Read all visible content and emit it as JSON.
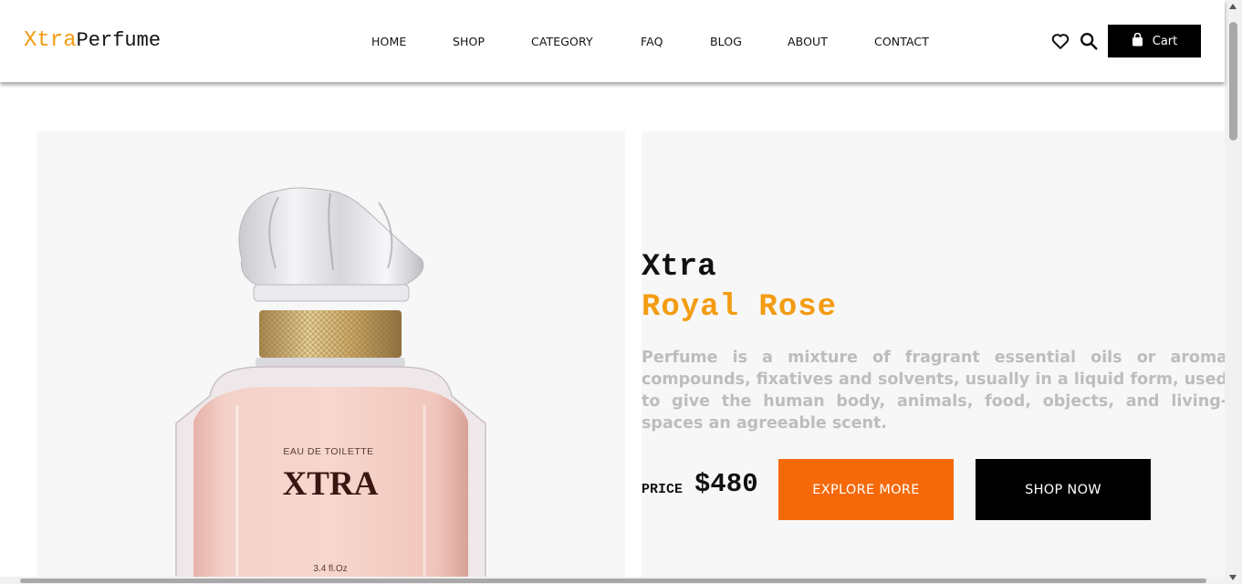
{
  "header": {
    "logo_part1": "Xtra",
    "logo_part2": "Perfume",
    "nav": [
      "HOME",
      "SHOP",
      "CATEGORY",
      "FAQ",
      "BLOG",
      "ABOUT",
      "CONTACT"
    ],
    "wishlist_icon": "heart-icon",
    "search_icon": "search-icon",
    "cart_icon": "shopping-bag-icon",
    "cart_label": "Cart"
  },
  "hero": {
    "product_image": {
      "label_top": "EAU DE TOILETTE",
      "brand": "XTRA",
      "volume": "3.4 fl.Oz"
    },
    "title_line1": "Xtra",
    "title_line2": "Royal Rose",
    "description": "Perfume is a mixture of fragrant essential oils or aroma compounds, fixatives and solvents, usually in a liquid form, used to give the human body, animals, food, objects, and living-spaces an agreeable scent.",
    "price_label": "PRICE",
    "price_value": "$480",
    "explore_button": "EXPLORE MORE",
    "shop_button": "SHOP NOW"
  },
  "colors": {
    "accent": "#f39c12",
    "explore_button_bg": "#f5690a",
    "dark": "#000000",
    "panel_bg": "#f7f7f7",
    "description_text": "#bdbdbd"
  }
}
